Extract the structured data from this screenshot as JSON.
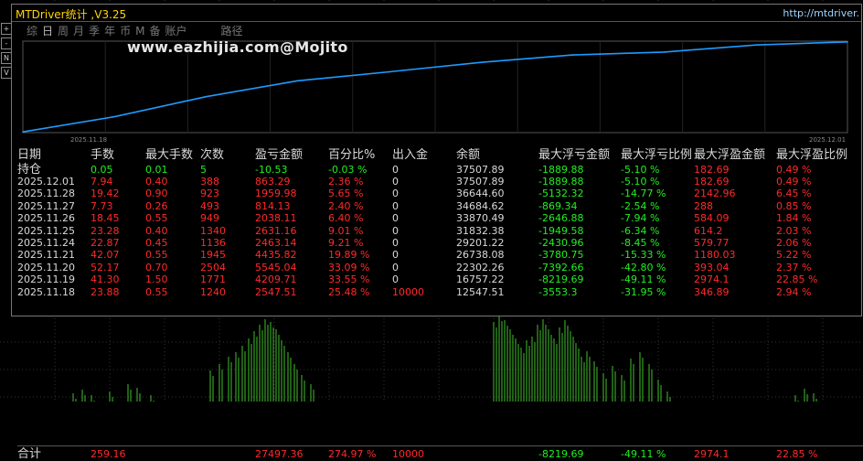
{
  "window": {
    "title": "MTDriver统计 ,V3.25",
    "url": "http://mtdriver."
  },
  "tabs": [
    "综",
    "日",
    "周",
    "月",
    "季",
    "年",
    "币",
    "M",
    "备",
    "账户",
    "路径"
  ],
  "active_tab": "日",
  "watermark": "www.eazhijia.com@Mojito",
  "left_toolbar": [
    "+",
    "-",
    "N",
    "V"
  ],
  "chart_data": {
    "type": "line",
    "x": [
      "2025.11.18",
      "2025.11.19",
      "2025.11.20",
      "2025.11.21",
      "2025.11.24",
      "2025.11.25",
      "2025.11.26",
      "2025.11.27",
      "2025.11.28",
      "2025.12.01"
    ],
    "series": [
      {
        "values": [
          12547.51,
          16757.22,
          22302.26,
          26738.08,
          29201.22,
          31832.38,
          33870.49,
          34684.62,
          36644.6,
          37507.89
        ]
      }
    ],
    "x_tick_labels": [
      "2025.11.18",
      "2025.12.01"
    ],
    "line_color": "#1e9bff",
    "grid": true
  },
  "table": {
    "headers": [
      "日期",
      "手数",
      "最大手数",
      "次数",
      "盈亏金额",
      "百分比%",
      "出入金",
      "余额",
      "最大浮亏金额",
      "最大浮亏比例",
      "最大浮盈金额",
      "最大浮盈比例"
    ],
    "holding": {
      "label": "持仓",
      "lots": "0.05",
      "max_lots": "0.01",
      "count": "5",
      "pnl": "-10.53",
      "pct": "-0.03 %",
      "flow": "0",
      "balance": "37507.89",
      "max_float_loss": "-1889.88",
      "max_float_loss_pct": "-5.10 %",
      "max_float_profit": "182.69",
      "max_float_profit_pct": "0.49 %"
    },
    "rows": [
      {
        "date": "2025.12.01",
        "lots": "7.94",
        "max_lots": "0.40",
        "count": "388",
        "pnl": "863.29",
        "pct": "2.36 %",
        "flow": "0",
        "balance": "37507.89",
        "max_float_loss": "-1889.88",
        "max_float_loss_pct": "-5.10 %",
        "max_float_profit": "182.69",
        "max_float_profit_pct": "0.49 %"
      },
      {
        "date": "2025.11.28",
        "lots": "19.42",
        "max_lots": "0.90",
        "count": "923",
        "pnl": "1959.98",
        "pct": "5.65 %",
        "flow": "0",
        "balance": "36644.60",
        "max_float_loss": "-5132.32",
        "max_float_loss_pct": "-14.77 %",
        "max_float_profit": "2142.96",
        "max_float_profit_pct": "6.45 %"
      },
      {
        "date": "2025.11.27",
        "lots": "7.73",
        "max_lots": "0.26",
        "count": "493",
        "pnl": "814.13",
        "pct": "2.40 %",
        "flow": "0",
        "balance": "34684.62",
        "max_float_loss": "-869.34",
        "max_float_loss_pct": "-2.54 %",
        "max_float_profit": "288",
        "max_float_profit_pct": "0.85 %"
      },
      {
        "date": "2025.11.26",
        "lots": "18.45",
        "max_lots": "0.55",
        "count": "949",
        "pnl": "2038.11",
        "pct": "6.40 %",
        "flow": "0",
        "balance": "33870.49",
        "max_float_loss": "-2646.88",
        "max_float_loss_pct": "-7.94 %",
        "max_float_profit": "584.09",
        "max_float_profit_pct": "1.84 %"
      },
      {
        "date": "2025.11.25",
        "lots": "23.28",
        "max_lots": "0.40",
        "count": "1340",
        "pnl": "2631.16",
        "pct": "9.01 %",
        "flow": "0",
        "balance": "31832.38",
        "max_float_loss": "-1949.58",
        "max_float_loss_pct": "-6.34 %",
        "max_float_profit": "614.2",
        "max_float_profit_pct": "2.03 %"
      },
      {
        "date": "2025.11.24",
        "lots": "22.87",
        "max_lots": "0.45",
        "count": "1136",
        "pnl": "2463.14",
        "pct": "9.21 %",
        "flow": "0",
        "balance": "29201.22",
        "max_float_loss": "-2430.96",
        "max_float_loss_pct": "-8.45 %",
        "max_float_profit": "579.77",
        "max_float_profit_pct": "2.06 %"
      },
      {
        "date": "2025.11.21",
        "lots": "42.07",
        "max_lots": "0.55",
        "count": "1945",
        "pnl": "4435.82",
        "pct": "19.89 %",
        "flow": "0",
        "balance": "26738.08",
        "max_float_loss": "-3780.75",
        "max_float_loss_pct": "-15.33 %",
        "max_float_profit": "1180.03",
        "max_float_profit_pct": "5.22 %"
      },
      {
        "date": "2025.11.20",
        "lots": "52.17",
        "max_lots": "0.70",
        "count": "2504",
        "pnl": "5545.04",
        "pct": "33.09 %",
        "flow": "0",
        "balance": "22302.26",
        "max_float_loss": "-7392.66",
        "max_float_loss_pct": "-42.80 %",
        "max_float_profit": "393.04",
        "max_float_profit_pct": "2.37 %"
      },
      {
        "date": "2025.11.19",
        "lots": "41.30",
        "max_lots": "1.50",
        "count": "1771",
        "pnl": "4209.71",
        "pct": "33.55 %",
        "flow": "0",
        "balance": "16757.22",
        "max_float_loss": "-8219.69",
        "max_float_loss_pct": "-49.11 %",
        "max_float_profit": "2974.1",
        "max_float_profit_pct": "22.85 %"
      },
      {
        "date": "2025.11.18",
        "lots": "23.88",
        "max_lots": "0.55",
        "count": "1240",
        "pnl": "2547.51",
        "pct": "25.48 %",
        "flow": "10000",
        "balance": "12547.51",
        "max_float_loss": "-3553.3",
        "max_float_loss_pct": "-31.95 %",
        "max_float_profit": "346.89",
        "max_float_profit_pct": "2.94 %"
      }
    ],
    "total": {
      "label": "合计",
      "lots": "259.16",
      "pnl": "27497.36",
      "pct": "274.97 %",
      "flow": "10000",
      "max_float_loss": "-8219.69",
      "max_float_loss_pct": "-49.11 %",
      "max_float_profit": "2974.1",
      "max_float_profit_pct": "22.85 %"
    }
  },
  "colors": {
    "title": "#ffd400",
    "positive": "#ff2a2a",
    "negative": "#22ee22",
    "holding": "#22ee22",
    "equity_line": "#1e9bff",
    "candles": "#3fbf2a"
  }
}
